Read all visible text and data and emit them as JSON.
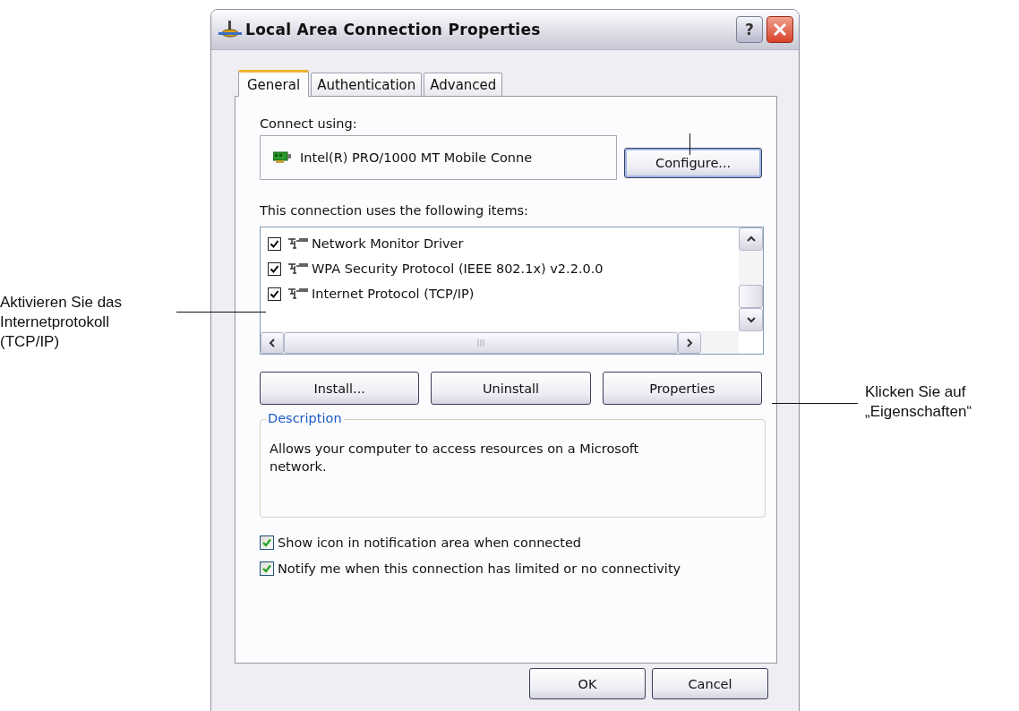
{
  "window": {
    "title": "Local Area Connection Properties",
    "help_button": "?"
  },
  "tabs": [
    {
      "label": "General",
      "selected": true
    },
    {
      "label": "Authentication",
      "selected": false
    },
    {
      "label": "Advanced",
      "selected": false
    }
  ],
  "connect_using": {
    "label": "Connect using:",
    "adapter": "Intel(R) PRO/1000 MT Mobile Conne",
    "configure_button": "Configure..."
  },
  "components": {
    "label": "This connection uses the following items:",
    "items": [
      {
        "name": "Network Monitor Driver",
        "checked": true
      },
      {
        "name": "WPA Security Protocol (IEEE 802.1x) v2.2.0.0",
        "checked": true
      },
      {
        "name": "Internet Protocol (TCP/IP)",
        "checked": true
      }
    ]
  },
  "component_buttons": [
    "Install...",
    "Uninstall",
    "Properties"
  ],
  "description": {
    "title": "Description",
    "text": "Allows your computer to access resources on a Microsoft network."
  },
  "options": [
    {
      "label": "Show icon in notification area when connected",
      "checked": true
    },
    {
      "label": "Notify me when this connection has limited or no connectivity",
      "checked": true
    }
  ],
  "buttons": [
    "OK",
    "Cancel"
  ],
  "left_note": "Aktivieren Sie das Internetprotokoll (TCP/IP)",
  "right_note": "Klicken Sie auf „Eigenschaften“"
}
